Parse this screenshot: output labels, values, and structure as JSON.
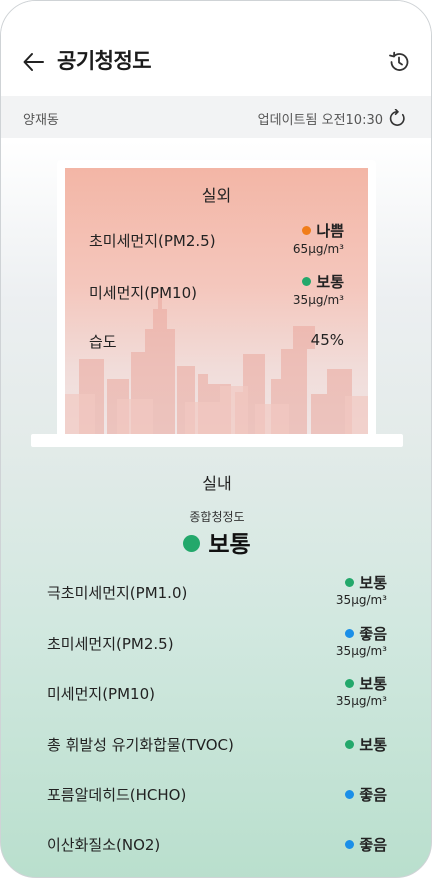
{
  "header": {
    "title": "공기청정도",
    "back_icon": "arrow-left-icon",
    "history_icon": "history-icon"
  },
  "location_bar": {
    "location": "양재동",
    "updated": "업데이트됨 오전10:30",
    "refresh_icon": "refresh-icon"
  },
  "outdoor": {
    "label": "실외",
    "rows": [
      {
        "label": "초미세먼지(PM2.5)",
        "status": "나쁨",
        "color": "#f07d1a",
        "value": "65µg/m³"
      },
      {
        "label": "미세먼지(PM10)",
        "status": "보통",
        "color": "#23a86b",
        "value": "35µg/m³"
      },
      {
        "label": "습도",
        "status": "45%",
        "color": "",
        "value": ""
      }
    ]
  },
  "indoor": {
    "label": "실내",
    "overall_label": "종합청정도",
    "overall_status": "보통",
    "overall_color": "#23a86b",
    "rows": [
      {
        "label": "극초미세먼지(PM1.0)",
        "status": "보통",
        "color": "#23a86b",
        "value": "35µg/m³"
      },
      {
        "label": "초미세먼지(PM2.5)",
        "status": "좋음",
        "color": "#1b8fe8",
        "value": "35µg/m³"
      },
      {
        "label": "미세먼지(PM10)",
        "status": "보통",
        "color": "#23a86b",
        "value": "35µg/m³"
      },
      {
        "label": "총 휘발성 유기화합물(TVOC)",
        "status": "보통",
        "color": "#23a86b",
        "value": ""
      },
      {
        "label": "포름알데히드(HCHO)",
        "status": "좋음",
        "color": "#1b8fe8",
        "value": ""
      },
      {
        "label": "이산화질소(NO2)",
        "status": "좋음",
        "color": "#1b8fe8",
        "value": ""
      }
    ]
  }
}
